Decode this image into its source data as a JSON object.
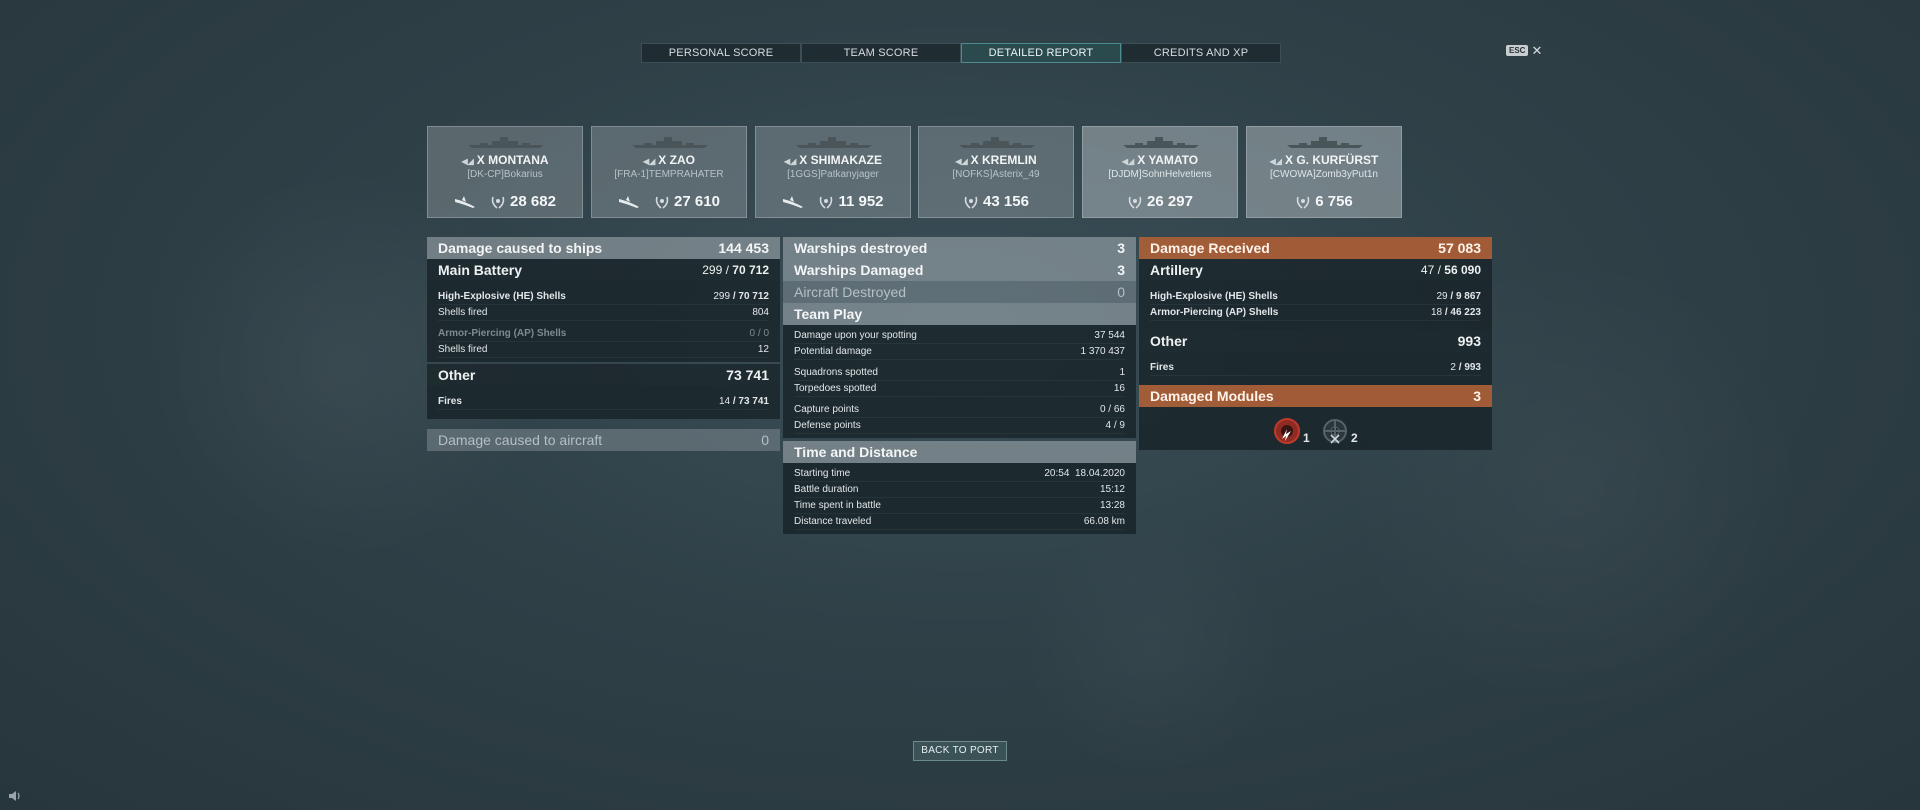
{
  "tabs": [
    {
      "label": "PERSONAL SCORE"
    },
    {
      "label": "TEAM SCORE"
    },
    {
      "label": "DETAILED REPORT"
    },
    {
      "label": "CREDITS AND XP"
    }
  ],
  "active_tab": "DETAILED REPORT",
  "esc": {
    "key": "ESC",
    "close": "✕"
  },
  "ships": [
    {
      "name": "MONTANA",
      "tier": "X",
      "player": "[DK-CP]Bokarius",
      "score": "28 682",
      "icons": [
        "plane-icon",
        "wreath-icon"
      ]
    },
    {
      "name": "ZAO",
      "tier": "X",
      "player": "[FRA-1]TEMPRAHATER",
      "score": "27 610",
      "icons": [
        "plane-icon",
        "wreath-icon"
      ]
    },
    {
      "name": "SHIMAKAZE",
      "tier": "X",
      "player": "[1GGS]Patkanyjager",
      "score": "11 952",
      "icons": [
        "plane-icon",
        "wreath-icon"
      ]
    },
    {
      "name": "KREMLIN",
      "tier": "X",
      "player": "[NOFKS]Asterix_49",
      "score": "43 156",
      "icons": [
        "wreath-icon"
      ]
    },
    {
      "name": "YAMATO",
      "tier": "X",
      "player": "[DJDM]SohnHelvetiens",
      "score": "26 297",
      "icons": [
        "wreath-icon"
      ]
    },
    {
      "name": "G. KURFÜRST",
      "tier": "X",
      "player": "[CWOWA]Zomb3yPut1n",
      "score": "6 756",
      "icons": [
        "wreath-icon"
      ]
    }
  ],
  "left": {
    "damage_caused": {
      "label": "Damage caused to ships",
      "value": "144 453"
    },
    "main_battery": {
      "label": "Main Battery",
      "hits": "299",
      "value": "70 712"
    },
    "he": {
      "label": "High-Explosive (HE) Shells",
      "hits": "299",
      "value": "70 712"
    },
    "he_fired": {
      "label": "Shells fired",
      "value": "804"
    },
    "ap": {
      "label": "Armor-Piercing (AP) Shells",
      "hits": "0",
      "value": "0"
    },
    "ap_fired": {
      "label": "Shells fired",
      "value": "12"
    },
    "other": {
      "label": "Other",
      "value": "73 741"
    },
    "fires": {
      "label": "Fires",
      "hits": "14",
      "value": "73 741"
    },
    "aircraft": {
      "label": "Damage caused to aircraft",
      "value": "0"
    }
  },
  "middle": {
    "destroyed": {
      "label": "Warships destroyed",
      "value": "3"
    },
    "damaged": {
      "label": "Warships Damaged",
      "value": "3"
    },
    "aircraft_destroyed": {
      "label": "Aircraft Destroyed",
      "value": "0"
    },
    "team_play": {
      "label": "Team Play"
    },
    "spotting": {
      "label": "Damage upon your spotting",
      "value": "37 544"
    },
    "potential": {
      "label": "Potential damage",
      "value": "1 370 437"
    },
    "squadrons": {
      "label": "Squadrons spotted",
      "value": "1"
    },
    "torpedoes": {
      "label": "Torpedoes spotted",
      "value": "16"
    },
    "capture": {
      "label": "Capture points",
      "value": "0 / 66"
    },
    "defense": {
      "label": "Defense points",
      "value": "4 / 9"
    },
    "time_distance": {
      "label": "Time and Distance"
    },
    "start": {
      "label": "Starting time",
      "value": "20:54  18.04.2020"
    },
    "duration": {
      "label": "Battle duration",
      "value": "15:12"
    },
    "spent": {
      "label": "Time spent in battle",
      "value": "13:28"
    },
    "distance": {
      "label": "Distance traveled",
      "value": "66.08 km"
    }
  },
  "right": {
    "received": {
      "label": "Damage Received",
      "value": "57 083"
    },
    "artillery": {
      "label": "Artillery",
      "hits": "47",
      "value": "56 090"
    },
    "he": {
      "label": "High-Explosive (HE) Shells",
      "hits": "29",
      "value": "9 867"
    },
    "ap": {
      "label": "Armor-Piercing (AP) Shells",
      "hits": "18",
      "value": "46 223"
    },
    "other": {
      "label": "Other",
      "value": "993"
    },
    "fires": {
      "label": "Fires",
      "hits": "2",
      "value": "993"
    },
    "modules": {
      "label": "Damaged Modules",
      "value": "3"
    },
    "module_icons": [
      {
        "icon": "engine-damage-icon",
        "count": "1",
        "color": "#c0392b"
      },
      {
        "icon": "steering-damage-icon",
        "count": "2",
        "color": "#3c4a50"
      }
    ]
  },
  "back_button": "BACK TO PORT"
}
